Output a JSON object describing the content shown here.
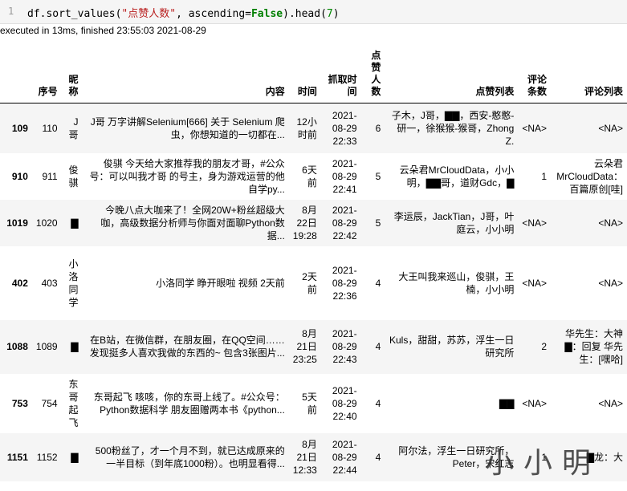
{
  "cell": {
    "line_number": "1",
    "code_prefix": "df.sort_values(",
    "code_string": "\"点赞人数\"",
    "code_middle": ", ascending=",
    "code_keyword": "False",
    "code_suffix": ").head(",
    "code_number": "7",
    "code_end": ")"
  },
  "execution": {
    "status": "executed in 13ms, finished 23:55:03 2021-08-29"
  },
  "table": {
    "headers": [
      "序号",
      "昵称",
      "内容",
      "时间",
      "抓取时间",
      "点赞人数",
      "点赞列表",
      "评论条数",
      "评论列表"
    ],
    "rows": [
      {
        "index": "109",
        "seq": "110",
        "nick": "J哥",
        "content": "J哥 万字讲解Selenium[666] 关于 Selenium 爬虫，你想知道的一切都在...",
        "time": "12小时前",
        "crawl": "2021-08-29 22:33",
        "likes": "6",
        "like_list": "子木，J哥，▇▇，西安-憨憨-研一，徐猴猴-猴哥，Zhong Z.",
        "comments": "<NA>",
        "comment_list": "<NA>"
      },
      {
        "index": "910",
        "seq": "911",
        "nick": "俊骐",
        "content": "俊骐 今天给大家推荐我的朋友才哥，#公众号：可以叫我才哥 的号主，身为游戏运营的他自学py...",
        "time": "6天前",
        "crawl": "2021-08-29 22:41",
        "likes": "5",
        "like_list": "云朵君MrCloudData，小小明，▇▇哥，道财Gdc，▇",
        "comments": "1",
        "comment_list": "云朵君 MrCloudData：百篇原创[哇]"
      },
      {
        "index": "1019",
        "seq": "1020",
        "nick": "▇",
        "content": "今晚八点大咖来了！全网20W+粉丝超级大咖，高级数据分析师与你面对面聊Python数据...",
        "time": "8月22日 19:28",
        "crawl": "2021-08-29 22:42",
        "likes": "5",
        "like_list": "李运辰，JackTian，J哥，叶庭云，小小明",
        "comments": "<NA>",
        "comment_list": "<NA>"
      },
      {
        "index": "402",
        "seq": "403",
        "nick": "小洛同学",
        "content": "小洛同学 睁开眼啦 视频 2天前",
        "time": "2天前",
        "crawl": "2021-08-29 22:36",
        "likes": "4",
        "like_list": "大王叫我来巡山，俊骐，王楠，小小明",
        "comments": "<NA>",
        "comment_list": "<NA>"
      },
      {
        "index": "1088",
        "seq": "1089",
        "nick": "▇",
        "content": "在B站，在微信群，在朋友圈，在QQ空间……发现挺多人喜欢我做的东西的~ 包含3张图片...",
        "time": "8月21日 23:25",
        "crawl": "2021-08-29 22:43",
        "likes": "4",
        "like_list": "Kuls，甜甜，苏苏，浮生一日研究所",
        "comments": "2",
        "comment_list": "华先生：大神 ▇：回复 华先生：[嘿哈]"
      },
      {
        "index": "753",
        "seq": "754",
        "nick": "东哥起飞",
        "content": "东哥起飞 咳咳，你的东哥上线了。#公众号：Python数据科学 朋友圈赠两本书《python...",
        "time": "5天前",
        "crawl": "2021-08-29 22:40",
        "likes": "4",
        "like_list": "▇▇",
        "comments": "<NA>",
        "comment_list": "<NA>"
      },
      {
        "index": "1151",
        "seq": "1152",
        "nick": "▇",
        "content": "500粉丝了，才一个月不到，就已达成原来的一半目标（到年底1000粉）。也明显看得...",
        "time": "8月21日 12:33",
        "crawl": "2021-08-29 22:44",
        "likes": "4",
        "like_list": "阿尔法，浮生一日研究所，Peter，宋红志",
        "comments": "1",
        "comment_list": "▇龙：大"
      }
    ]
  },
  "watermark": "小小明"
}
